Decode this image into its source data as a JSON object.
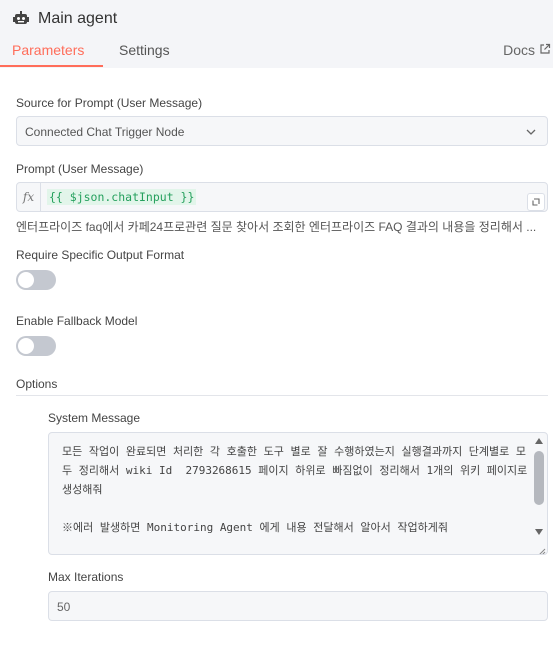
{
  "node": {
    "title": "Main agent",
    "icon": "robot-icon"
  },
  "tabs": [
    {
      "label": "Parameters",
      "active": true
    },
    {
      "label": "Settings",
      "active": false
    }
  ],
  "docs": {
    "label": "Docs",
    "icon": "external-link-icon"
  },
  "source": {
    "label": "Source for Prompt (User Message)",
    "value": "Connected Chat Trigger Node"
  },
  "prompt": {
    "label": "Prompt (User Message)",
    "fx": "fx",
    "expression": "{{ $json.chatInput }}",
    "hint": "엔터프라이즈 faq에서 카페24프로관련 질문 찾아서 조회한 엔터프라이즈 FAQ 결과의 내용을 정리해서 ..."
  },
  "require_output": {
    "label": "Require Specific Output Format",
    "enabled": false
  },
  "fallback": {
    "label": "Enable Fallback Model",
    "enabled": false
  },
  "options": {
    "label": "Options",
    "system_message": {
      "label": "System Message",
      "value": "모든 작업이 완료되면 처리한 각 호출한 도구 별로 잘 수행하였는지 실행결과까지 단계별로 모두 정리해서 wiki Id  2793268615 페이지 하위로 빠짐없이 정리해서 1개의 위키 페이지로 생성해줘\n\n※에러 발생하면 Monitoring Agent 에게 내용 전달해서 알아서 작업하게줘"
    },
    "max_iterations": {
      "label": "Max Iterations",
      "value": "50"
    }
  },
  "colors": {
    "accent": "#ff6d5a",
    "expression": "#25a05d",
    "expression_bg": "#e2f5ea"
  }
}
